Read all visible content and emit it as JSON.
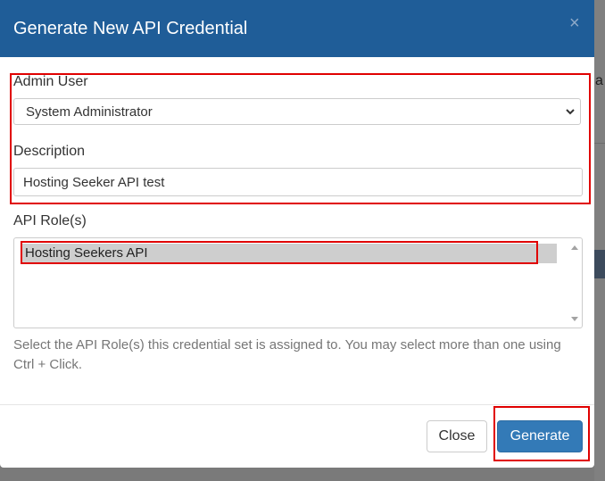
{
  "modal": {
    "title": "Generate New API Credential",
    "close_glyph": "×"
  },
  "form": {
    "admin_user": {
      "label": "Admin User",
      "selected": "System Administrator"
    },
    "description": {
      "label": "Description",
      "value": "Hosting Seeker API test"
    },
    "api_roles": {
      "label": "API Role(s)",
      "options": [
        "Hosting Seekers API"
      ],
      "help": "Select the API Role(s) this credential set is assigned to. You may select more than one using Ctrl + Click."
    }
  },
  "footer": {
    "close_label": "Close",
    "generate_label": "Generate"
  },
  "background": {
    "glyph": "a"
  },
  "colors": {
    "header": "#1f5d98",
    "primary_button": "#337ab7",
    "highlight": "#e00000"
  },
  "icons": {
    "close": "close-icon",
    "dropdown": "chevron-down-icon",
    "scroll_up": "scroll-up-arrow-icon",
    "scroll_down": "scroll-down-arrow-icon"
  }
}
